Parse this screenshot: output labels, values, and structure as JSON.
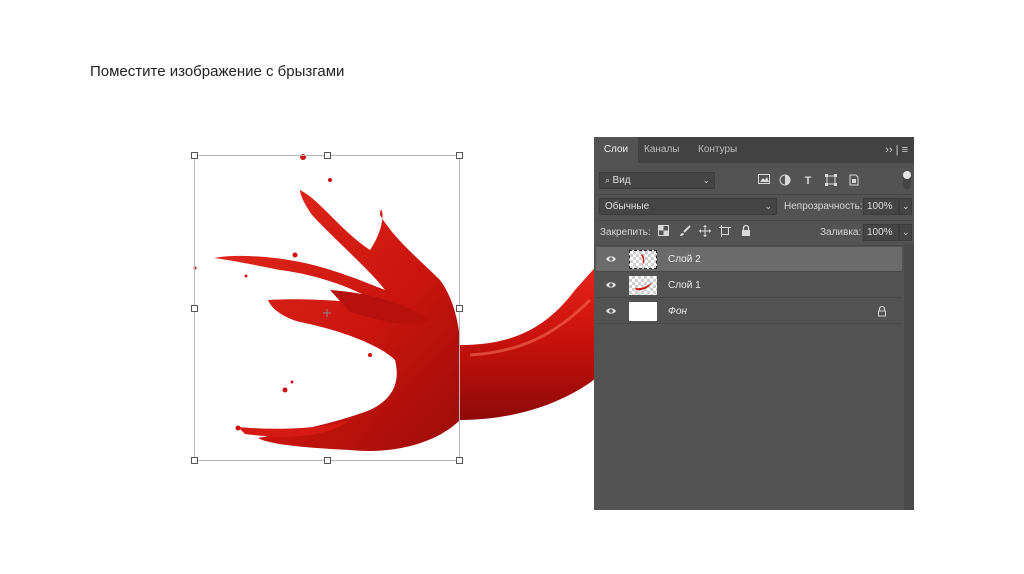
{
  "slide": {
    "title": "Поместите изображение с брызгами"
  },
  "colors": {
    "accent_red": "#d01010",
    "panel_bg": "#535353",
    "selected_layer_bg": "#6b6b6b"
  },
  "layers_panel": {
    "tabs": [
      {
        "label": "Слои",
        "active": true
      },
      {
        "label": "Каналы",
        "active": false
      },
      {
        "label": "Контуры",
        "active": false
      }
    ],
    "tab_menu": "›› | ≡",
    "filter": {
      "value": "Вид"
    },
    "blend_mode": {
      "value": "Обычные"
    },
    "opacity": {
      "label": "Непрозрачность:",
      "value": "100%"
    },
    "lock": {
      "label": "Закрепить:"
    },
    "fill": {
      "label": "Заливка:",
      "value": "100%"
    },
    "layers": [
      {
        "name": "Слой 2",
        "selected": true,
        "thumb": "splash"
      },
      {
        "name": "Слой 1",
        "selected": false,
        "thumb": "pepper"
      },
      {
        "name": "Фон",
        "selected": false,
        "thumb": "white",
        "locked": true
      }
    ]
  }
}
